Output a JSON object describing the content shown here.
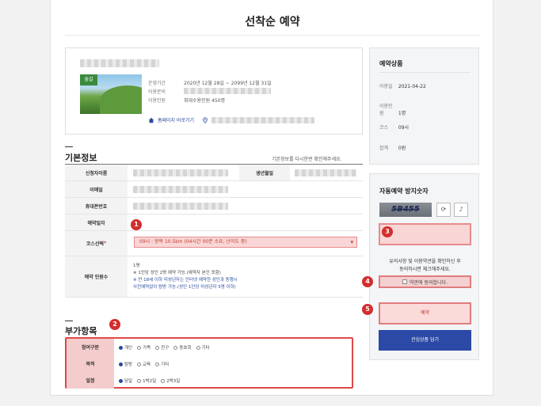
{
  "page": {
    "title": "선착순 예약"
  },
  "product": {
    "badge": "숲길",
    "meta": [
      {
        "key": "운영기간",
        "value": "2020년 12월 28일 ~ 2099년 12월 31일"
      },
      {
        "key": "이용문의",
        "value": ""
      },
      {
        "key": "이용인원",
        "value": "최대수용인원 450명"
      }
    ],
    "homepage_link": "홈페이지 바로가기"
  },
  "summary": {
    "heading": "예약상품",
    "rows": [
      {
        "key": "이용일",
        "value": "2021-04-22"
      },
      {
        "key": "이용인원",
        "value": "1명"
      },
      {
        "key": "코스",
        "value": "09시"
      },
      {
        "key": "합계",
        "value": "0원"
      }
    ]
  },
  "basic": {
    "heading": "기본정보",
    "hint": "기본정보를 다시한번 확인해주세요.",
    "labels": {
      "applicant": "신청자이름",
      "birth": "생년월일",
      "email": "이메일",
      "phone": "휴대폰번호",
      "date": "예약일자",
      "course": "코스선택",
      "count": "예약 인원수"
    },
    "course_value": "09시 : 왕복 10.5km (04시간 00분 소요, 난이도 중)",
    "count_value": "1명",
    "notes": [
      "※ 1인당 성인 2명 예약 가능.(예약자 본인 포함)",
      "※ 만 18세 이하 미성년자는 인터넷 예약한 성인과 동행시",
      "사전예약없이 탐방 가능.(성인 1인당 미성년자 5명 이하)"
    ]
  },
  "extra": {
    "heading": "부가항목",
    "rows": [
      {
        "label": "참여구분",
        "options": [
          "개인",
          "가족",
          "친구",
          "동호회",
          "기타"
        ],
        "selected": 0
      },
      {
        "label": "목적",
        "options": [
          "탐방",
          "교육",
          "기타"
        ],
        "selected": 0
      },
      {
        "label": "일정",
        "options": [
          "당일",
          "1박2일",
          "2박3일"
        ],
        "selected": 0
      }
    ]
  },
  "captcha": {
    "heading": "자동예약 방지숫자",
    "code": "5B455",
    "refresh_icon": "refresh-icon",
    "audio_icon": "speaker-icon",
    "consent_line1": "유의사항 및 이용약관을 확인하신 후",
    "consent_line2": "동의하시면 체크해주세요.",
    "agree_label": "약관에 동의합니다.",
    "reserve_label": "예약",
    "wish_label": "관심상품 담기"
  },
  "markers": [
    "1",
    "2",
    "3",
    "4",
    "5"
  ],
  "colors": {
    "accent_red": "#d42d2d",
    "primary_blue": "#2b49a5"
  }
}
